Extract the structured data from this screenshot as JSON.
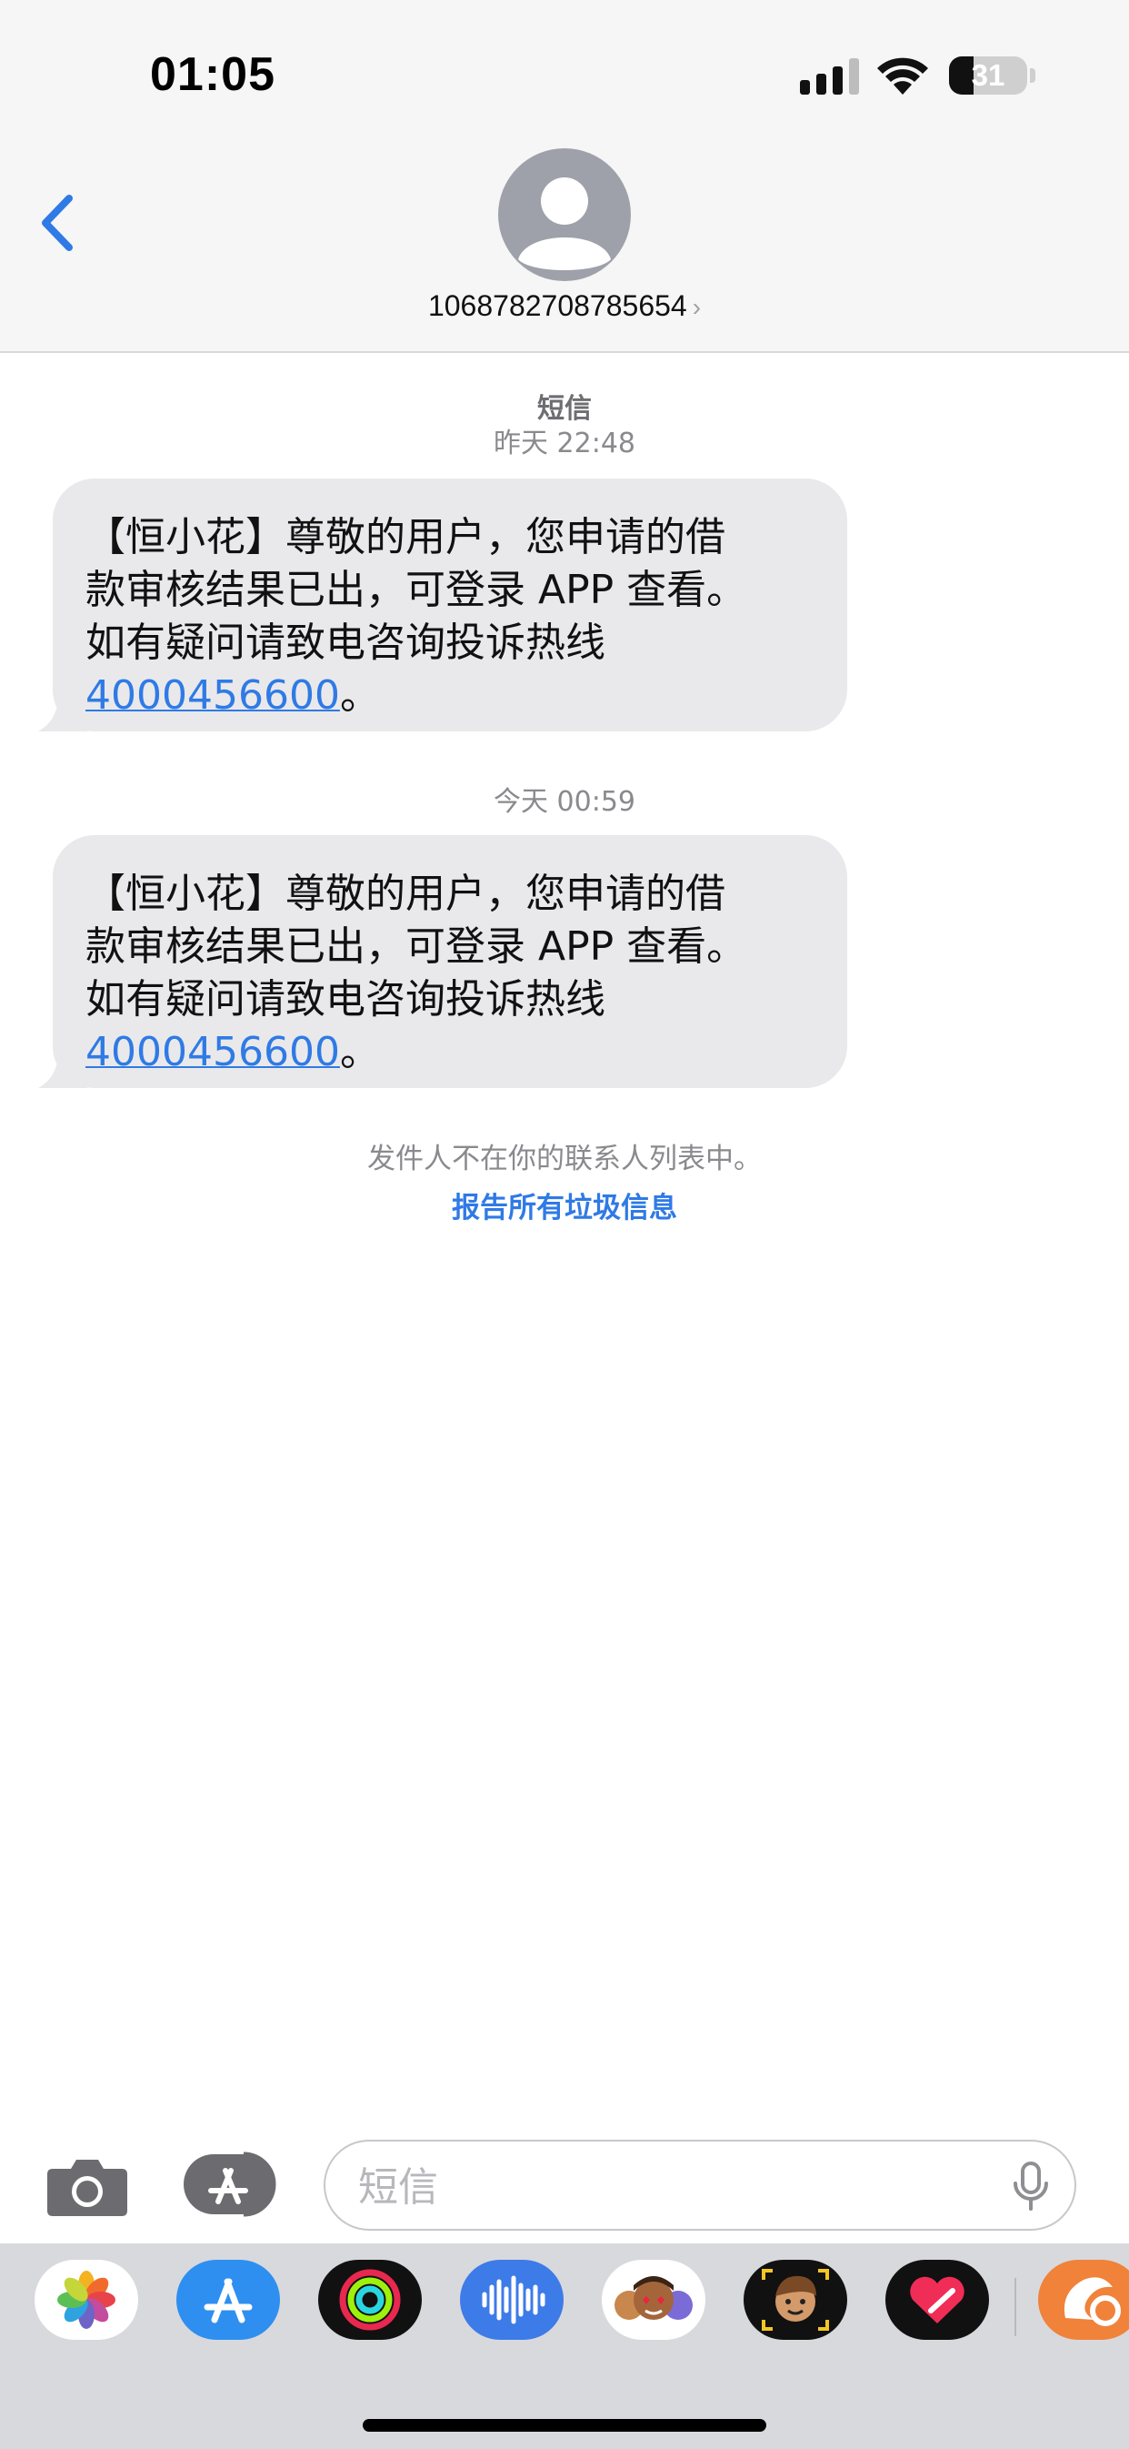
{
  "status_bar": {
    "time": "01:05",
    "battery_level": "31",
    "battery_fraction": 0.31
  },
  "header": {
    "back_icon": "chevron-left-icon",
    "contact_number": "1068782708785654",
    "detail_chevron": "›"
  },
  "conversation": {
    "messages": [
      {
        "service": "短信",
        "timestamp": "昨天 22:48",
        "text_lines": [
          "【恒小花】尊敬的用户，您申请的借",
          "款审核结果已出，可登录 APP 查看。",
          "如有疑问请致电咨询投诉热线"
        ],
        "phone_link": "4000456600",
        "end_punct": "。"
      },
      {
        "timestamp": "今天 00:59",
        "text_lines": [
          "【恒小花】尊敬的用户，您申请的借",
          "款审核结果已出，可登录 APP 查看。",
          "如有疑问请致电咨询投诉热线"
        ],
        "phone_link": "4000456600",
        "end_punct": "。"
      }
    ],
    "not_in_contacts": "发件人不在你的联系人列表中。",
    "report_junk": "报告所有垃圾信息"
  },
  "compose": {
    "placeholder": "短信",
    "camera_icon": "camera-icon",
    "apps_icon": "app-store-icon",
    "mic_icon": "microphone-icon"
  },
  "app_drawer": {
    "apps": [
      "photos-icon",
      "app-store-icon",
      "activity-icon",
      "audio-message-icon",
      "memoji-stickers-icon",
      "memoji-icon",
      "digital-touch-icon",
      "orange-app-icon"
    ]
  },
  "colors": {
    "accent": "#2f7ae5",
    "bubble": "#e9e9eb",
    "header_bg": "#f6f6f6",
    "drawer_bg": "#d8d9dd"
  }
}
